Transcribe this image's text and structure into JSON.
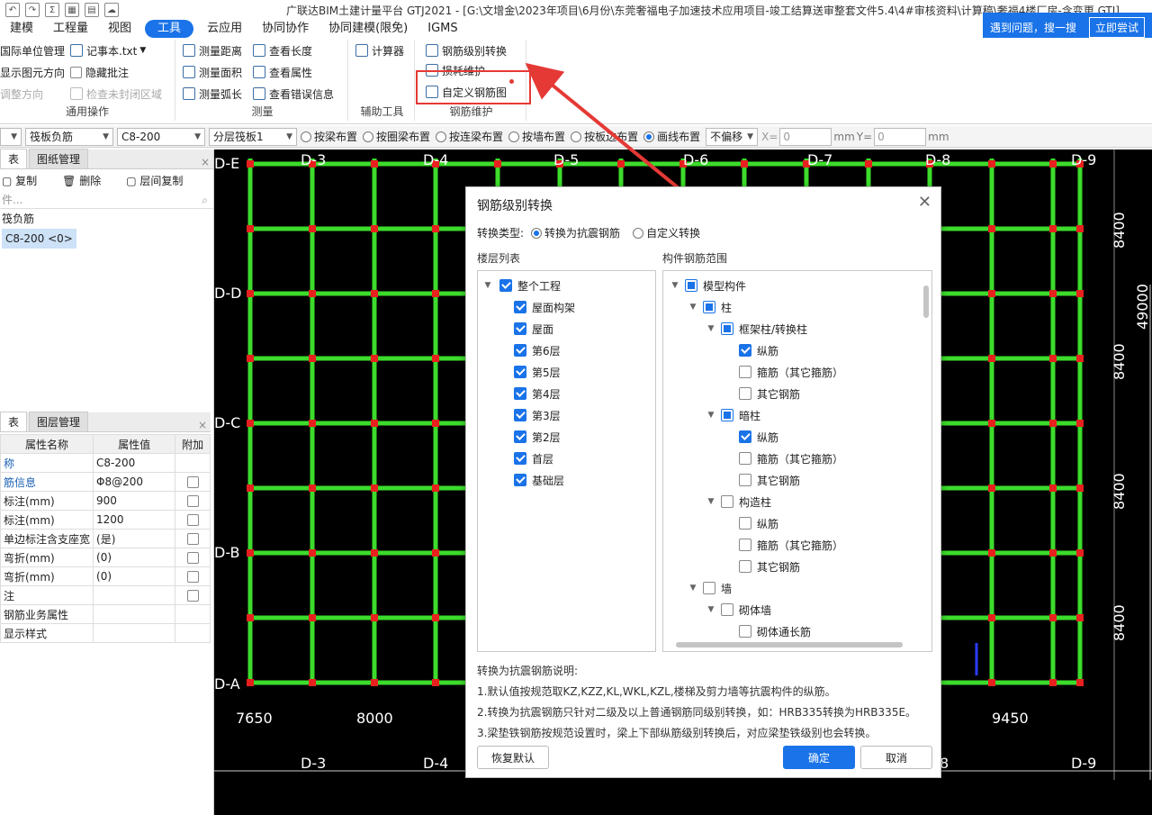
{
  "window": {
    "title": "广联达BIM土建计量平台 GTJ2021 - [G:\\文增金\\2023年项目\\6月份\\东莞奢福电子加速技术应用项目-竣工结算送审整套文件5.4\\4#审核资料\\计算稿\\奢福4楼厂房-含变更.GTJ]"
  },
  "menu": {
    "items": [
      "建模",
      "工程量",
      "视图",
      "工具",
      "云应用",
      "协同协作",
      "协同建模(限免)",
      "IGMS"
    ]
  },
  "help": {
    "text": "遇到问题，搜一搜",
    "button": "立即尝试"
  },
  "ribbon": {
    "general": {
      "label": "通用操作",
      "items": [
        "国际单位管理",
        "记事本.txt",
        "显示图元方向",
        "隐藏批注",
        "调整方向",
        "检查未封闭区域"
      ]
    },
    "measure": {
      "label": "测量",
      "items": [
        "测量距离",
        "查看长度",
        "测量面积",
        "查看属性",
        "测量弧长",
        "查看错误信息"
      ]
    },
    "aux": {
      "label": "辅助工具",
      "items": [
        "计算器"
      ]
    },
    "rebar": {
      "label": "钢筋维护",
      "items": [
        "钢筋级别转换",
        "损耗维护",
        "自定义钢筋图"
      ]
    }
  },
  "toolbar2": {
    "combo1": "",
    "combo2": "筏板负筋",
    "combo3": "C8-200",
    "combo4": "分层筏板1",
    "radios": [
      "按梁布置",
      "按圈梁布置",
      "按连梁布置",
      "按墙布置",
      "按板边布置",
      "画线布置"
    ],
    "offset": "不偏移",
    "x_label": "X=",
    "x_value": "0",
    "y_label": "Y=",
    "y_value": "0",
    "unit": "mm"
  },
  "left_panel": {
    "tabs_top": [
      "表",
      "图纸管理"
    ],
    "actions": [
      "复制",
      "删除",
      "层间复制"
    ],
    "search_placeholder": "件...",
    "tree": [
      "筏负筋",
      "C8-200 <0>"
    ],
    "tabs_prop": [
      "表",
      "图层管理"
    ],
    "prop_headers": [
      "属性名称",
      "属性值",
      "附加"
    ],
    "props": [
      {
        "name": "称",
        "value": "C8-200",
        "link": true
      },
      {
        "name": "筋信息",
        "value": "Φ8@200",
        "link": true
      },
      {
        "name": "标注(mm)",
        "value": "900",
        "link": false
      },
      {
        "name": "标注(mm)",
        "value": "1200",
        "link": false
      },
      {
        "name": "单边标注含支座宽",
        "value": "(是)",
        "link": false
      },
      {
        "name": "弯折(mm)",
        "value": "(0)",
        "link": false
      },
      {
        "name": "弯折(mm)",
        "value": "(0)",
        "link": false
      },
      {
        "name": "注",
        "value": "",
        "link": false
      },
      {
        "name": "钢筋业务属性",
        "value": "",
        "link": false
      },
      {
        "name": "显示样式",
        "value": "",
        "link": false
      }
    ]
  },
  "canvas": {
    "top_axes": [
      "D-3",
      "D-4",
      "D-5",
      "D-6",
      "D-7",
      "D-8",
      "D-9"
    ],
    "left_axes": [
      "D-E",
      "D-D",
      "D-C",
      "D-B",
      "D-A"
    ],
    "bottom_axes": [
      "D-3",
      "D-4",
      "8",
      "D-9"
    ],
    "bottom_dims": [
      "7650",
      "8000",
      "9450"
    ],
    "right_dims": [
      "8400",
      "8400",
      "8400",
      "8400"
    ],
    "total_dim": "49000"
  },
  "dialog": {
    "title": "钢筋级别转换",
    "conv_type_label": "转换类型:",
    "conv_options": [
      "转换为抗震钢筋",
      "自定义转换"
    ],
    "floor_list_label": "楼层列表",
    "range_label": "构件钢筋范围",
    "floors": [
      "整个工程",
      "屋面构架",
      "屋面",
      "第6层",
      "第5层",
      "第4层",
      "第3层",
      "第2层",
      "首层",
      "基础层"
    ],
    "components": [
      {
        "label": "模型构件",
        "level": 0,
        "state": "part",
        "exp": true
      },
      {
        "label": "柱",
        "level": 1,
        "state": "part",
        "exp": true
      },
      {
        "label": "框架柱/转换柱",
        "level": 2,
        "state": "part",
        "exp": true
      },
      {
        "label": "纵筋",
        "level": 3,
        "state": "on",
        "exp": false
      },
      {
        "label": "箍筋（其它箍筋）",
        "level": 3,
        "state": "off",
        "exp": false
      },
      {
        "label": "其它钢筋",
        "level": 3,
        "state": "off",
        "exp": false
      },
      {
        "label": "暗柱",
        "level": 2,
        "state": "part",
        "exp": true
      },
      {
        "label": "纵筋",
        "level": 3,
        "state": "on",
        "exp": false
      },
      {
        "label": "箍筋（其它箍筋）",
        "level": 3,
        "state": "off",
        "exp": false
      },
      {
        "label": "其它钢筋",
        "level": 3,
        "state": "off",
        "exp": false
      },
      {
        "label": "构造柱",
        "level": 2,
        "state": "off",
        "exp": true
      },
      {
        "label": "纵筋",
        "level": 3,
        "state": "off",
        "exp": false
      },
      {
        "label": "箍筋（其它箍筋）",
        "level": 3,
        "state": "off",
        "exp": false
      },
      {
        "label": "其它钢筋",
        "level": 3,
        "state": "off",
        "exp": false
      },
      {
        "label": "墙",
        "level": 1,
        "state": "off",
        "exp": true
      },
      {
        "label": "砌体墙",
        "level": 2,
        "state": "off",
        "exp": true
      },
      {
        "label": "砌体通长筋",
        "level": 3,
        "state": "off",
        "exp": false
      }
    ],
    "desc_title": "转换为抗震钢筋说明:",
    "desc_lines": [
      "1.默认值按规范取KZ,KZZ,KL,WKL,KZL,楼梯及剪力墙等抗震构件的纵筋。",
      "2.转换为抗震钢筋只针对二级及以上普通钢筋同级别转换，如：HRB335转换为HRB335E。",
      "3.梁垫铁钢筋按规范设置时，梁上下部纵筋级别转换后，对应梁垫铁级别也会转换。"
    ],
    "btn_reset": "恢复默认",
    "btn_ok": "确定",
    "btn_cancel": "取消"
  },
  "colors": {
    "accent": "#1a73e8",
    "highlight": "#e53935",
    "grid": "#3ddc2c"
  }
}
